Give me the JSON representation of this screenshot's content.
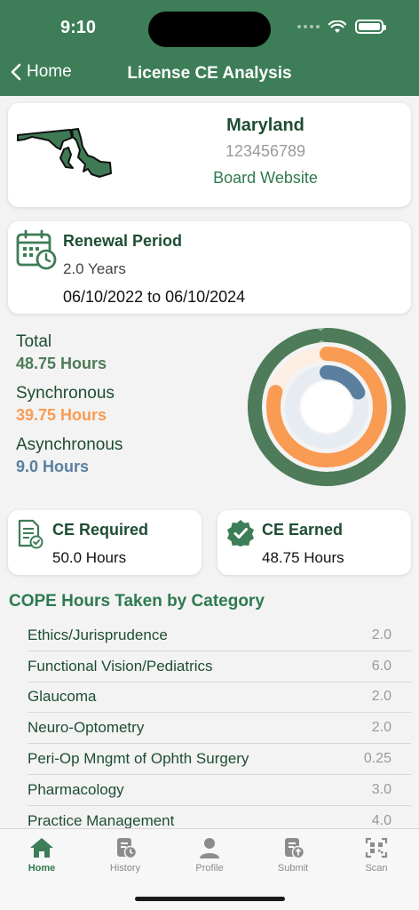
{
  "status": {
    "time": "9:10"
  },
  "nav": {
    "back_label": "Home",
    "title": "License CE Analysis"
  },
  "license": {
    "state": "Maryland",
    "number": "123456789",
    "board_link": "Board Website"
  },
  "renewal": {
    "title": "Renewal Period",
    "years": "2.0 Years",
    "dates": "06/10/2022 to 06/10/2024"
  },
  "hours": {
    "total_label": "Total",
    "total_value": "48.75 Hours",
    "sync_label": "Synchronous",
    "sync_value": "39.75 Hours",
    "async_label": "Asynchronous",
    "async_value": "9.0 Hours"
  },
  "colors": {
    "brand": "#3d7d57",
    "total": "#4e7b59",
    "sync": "#f99b53",
    "async": "#5a7f9f"
  },
  "ring_levels": {
    "total_fraction": 0.975,
    "sync_fraction": 0.795,
    "async_fraction": 0.18
  },
  "ce_required": {
    "title": "CE Required",
    "value": "50.0 Hours"
  },
  "ce_earned": {
    "title": "CE Earned",
    "value": "48.75 Hours"
  },
  "categories_title": "COPE Hours Taken by Category",
  "categories": [
    {
      "name": "Ethics/Jurisprudence",
      "value": "2.0"
    },
    {
      "name": "Functional Vision/Pediatrics",
      "value": "6.0"
    },
    {
      "name": "Glaucoma",
      "value": "2.0"
    },
    {
      "name": "Neuro-Optometry",
      "value": "2.0"
    },
    {
      "name": "Peri-Op Mngmt of Ophth Surgery",
      "value": "0.25"
    },
    {
      "name": "Pharmacology",
      "value": "3.0"
    },
    {
      "name": "Practice Management",
      "value": "4.0"
    }
  ],
  "tabs": [
    {
      "label": "Home",
      "icon": "home-icon"
    },
    {
      "label": "History",
      "icon": "history-icon"
    },
    {
      "label": "Profile",
      "icon": "profile-icon"
    },
    {
      "label": "Submit",
      "icon": "submit-icon"
    },
    {
      "label": "Scan",
      "icon": "scan-icon"
    }
  ]
}
